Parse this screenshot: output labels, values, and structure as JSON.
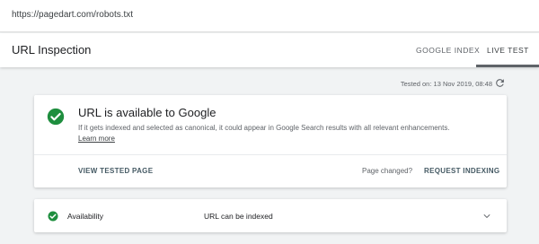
{
  "url_bar": {
    "url": "https://pagedart.com/robots.txt"
  },
  "header": {
    "title": "URL Inspection",
    "tabs": [
      {
        "label": "GOOGLE INDEX",
        "active": false
      },
      {
        "label": "LIVE TEST",
        "active": true
      }
    ]
  },
  "tested_on": "Tested on: 13 Nov 2019, 08:48",
  "result_card": {
    "headline": "URL is available to Google",
    "description": "If it gets indexed and selected as canonical, it could appear in Google Search results with all relevant enhancements.",
    "learn_more": "Learn more",
    "view_button": "VIEW TESTED PAGE",
    "page_changed": "Page changed?",
    "request_button": "REQUEST INDEXING"
  },
  "availability": {
    "label": "Availability",
    "status": "URL can be indexed"
  },
  "colors": {
    "success_green": "#1e8e3e",
    "action_text": "#455a64",
    "background": "#f1f3f4"
  },
  "icons": {
    "success": "check-circle-icon",
    "refresh": "refresh-icon",
    "expand": "chevron-down-icon"
  }
}
